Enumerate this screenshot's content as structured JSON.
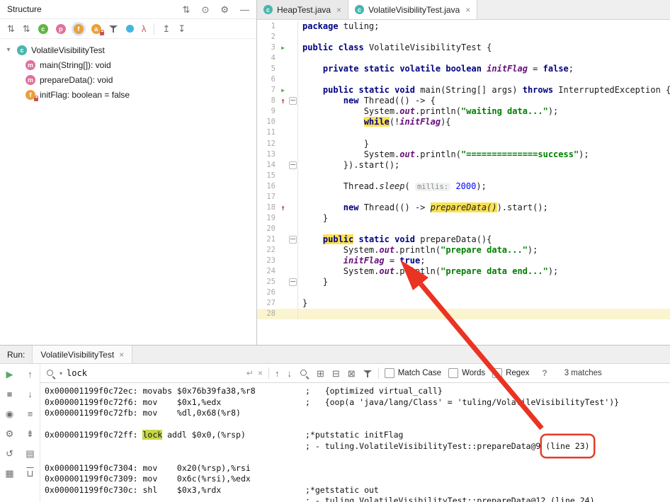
{
  "structure_panel": {
    "title": "Structure",
    "header_icons": [
      {
        "name": "sort-icon",
        "glyph": "⇅"
      },
      {
        "name": "locate-icon",
        "glyph": "⊙"
      },
      {
        "name": "settings-icon",
        "glyph": "⚙"
      },
      {
        "name": "hide-icon",
        "glyph": "—"
      }
    ],
    "toolbar_icons": [
      {
        "name": "sort-by-visibility-icon",
        "glyph": "⇅"
      },
      {
        "name": "sort-alphabetically-icon",
        "glyph": "⇅"
      },
      {
        "name": "show-inherited-icon",
        "chip": "c",
        "bg": "#62b543"
      },
      {
        "name": "show-properties-icon",
        "chip": "p",
        "bg": "#e0719c"
      },
      {
        "name": "show-fields-icon",
        "chip": "f",
        "bg": "#eaa13c",
        "selected": true
      },
      {
        "name": "show-anonymous-classes-icon",
        "chip": "a",
        "bg": "#eaa13c",
        "lock": true
      },
      {
        "name": "filter-icon",
        "funnel": true
      },
      {
        "name": "show-objects-icon",
        "dot": "#40b6e0"
      },
      {
        "name": "show-lambdas-icon",
        "glyph": "λ",
        "color": "#c75450"
      },
      {
        "name": "expand-all-icon",
        "glyph": "↥",
        "sep": true
      },
      {
        "name": "collapse-all-icon",
        "glyph": "↧"
      }
    ],
    "tree": [
      {
        "kind": "class",
        "label": "VolatileVisibilityTest",
        "icon": "c",
        "bg": "#49b6ad",
        "level": 0,
        "chevron": "▾"
      },
      {
        "kind": "method",
        "label": "main(String[]): void",
        "icon": "m",
        "bg": "#e0719c",
        "level": 1
      },
      {
        "kind": "method",
        "label": "prepareData(): void",
        "icon": "m",
        "bg": "#e0719c",
        "level": 1
      },
      {
        "kind": "field",
        "label": "initFlag: boolean = false",
        "icon": "f",
        "bg": "#eaa13c",
        "lock": true,
        "level": 1
      }
    ]
  },
  "editor": {
    "close_glyph": "×",
    "tabs": [
      {
        "label": "HeapTest.java",
        "active": false
      },
      {
        "label": "VolatileVisibilityTest.java",
        "active": true
      }
    ],
    "gutter_run_lines": [
      3,
      7
    ],
    "gutter_impl_lines": [
      8,
      18
    ],
    "fold_lines": [
      8,
      14,
      21,
      25
    ],
    "caret_line": 28,
    "lines": [
      {
        "n": 1,
        "s": [
          [
            "k",
            "package"
          ],
          [
            "p",
            " tuling;"
          ]
        ]
      },
      {
        "n": 2,
        "s": []
      },
      {
        "n": 3,
        "s": [
          [
            "k",
            "public"
          ],
          [
            "p",
            " "
          ],
          [
            "k",
            "class"
          ],
          [
            "p",
            " VolatileVisibilityTest {"
          ]
        ]
      },
      {
        "n": 4,
        "s": []
      },
      {
        "n": 5,
        "s": [
          [
            "p",
            "    "
          ],
          [
            "k",
            "private"
          ],
          [
            "p",
            " "
          ],
          [
            "k",
            "static"
          ],
          [
            "p",
            " "
          ],
          [
            "k",
            "volatile"
          ],
          [
            "p",
            " "
          ],
          [
            "k",
            "boolean"
          ],
          [
            "p",
            " "
          ],
          [
            "f",
            "initFlag"
          ],
          [
            "p",
            " = "
          ],
          [
            "k",
            "false"
          ],
          [
            "p",
            ";"
          ]
        ]
      },
      {
        "n": 6,
        "s": []
      },
      {
        "n": 7,
        "s": [
          [
            "p",
            "    "
          ],
          [
            "k",
            "public"
          ],
          [
            "p",
            " "
          ],
          [
            "k",
            "static"
          ],
          [
            "p",
            " "
          ],
          [
            "k",
            "void"
          ],
          [
            "p",
            " main(String[] args) "
          ],
          [
            "k",
            "throws"
          ],
          [
            "p",
            " InterruptedException {"
          ]
        ]
      },
      {
        "n": 8,
        "s": [
          [
            "p",
            "        "
          ],
          [
            "k",
            "new"
          ],
          [
            "p",
            " Thread(() -> {"
          ]
        ]
      },
      {
        "n": 9,
        "s": [
          [
            "p",
            "            System."
          ],
          [
            "f",
            "out"
          ],
          [
            "p",
            ".println("
          ],
          [
            "s2",
            "\"waiting data...\""
          ],
          [
            "p",
            ");"
          ]
        ]
      },
      {
        "n": 10,
        "s": [
          [
            "p",
            "            "
          ],
          [
            "khl",
            "while"
          ],
          [
            "p",
            "(!"
          ],
          [
            "f",
            "initFlag"
          ],
          [
            "p",
            "){"
          ]
        ]
      },
      {
        "n": 11,
        "s": []
      },
      {
        "n": 12,
        "s": [
          [
            "p",
            "            }"
          ]
        ]
      },
      {
        "n": 13,
        "s": [
          [
            "p",
            "            System."
          ],
          [
            "f",
            "out"
          ],
          [
            "p",
            ".println("
          ],
          [
            "s2",
            "\"==============success\""
          ],
          [
            "p",
            ");"
          ]
        ]
      },
      {
        "n": 14,
        "s": [
          [
            "p",
            "        }).start();"
          ]
        ]
      },
      {
        "n": 15,
        "s": []
      },
      {
        "n": 16,
        "s": [
          [
            "p",
            "        Thread."
          ],
          [
            "sm",
            "sleep"
          ],
          [
            "p",
            "( "
          ],
          [
            "hint",
            "millis:"
          ],
          [
            "p",
            " "
          ],
          [
            "num",
            "2000"
          ],
          [
            "p",
            ");"
          ]
        ]
      },
      {
        "n": 17,
        "s": []
      },
      {
        "n": 18,
        "s": [
          [
            "p",
            "        "
          ],
          [
            "k",
            "new"
          ],
          [
            "p",
            " Thread(() -> "
          ],
          [
            "smhl",
            "prepareData()"
          ],
          [
            "p",
            ").start();"
          ]
        ]
      },
      {
        "n": 19,
        "s": [
          [
            "p",
            "    }"
          ]
        ]
      },
      {
        "n": 20,
        "s": []
      },
      {
        "n": 21,
        "s": [
          [
            "p",
            "    "
          ],
          [
            "khl",
            "public"
          ],
          [
            "p",
            " "
          ],
          [
            "k",
            "static"
          ],
          [
            "p",
            " "
          ],
          [
            "k",
            "void"
          ],
          [
            "p",
            " prepareData(){"
          ]
        ]
      },
      {
        "n": 22,
        "s": [
          [
            "p",
            "        System."
          ],
          [
            "f",
            "out"
          ],
          [
            "p",
            ".println("
          ],
          [
            "s2",
            "\"prepare data...\""
          ],
          [
            "p",
            ");"
          ]
        ]
      },
      {
        "n": 23,
        "s": [
          [
            "p",
            "        "
          ],
          [
            "f",
            "initFlag"
          ],
          [
            "p",
            " = "
          ],
          [
            "k",
            "true"
          ],
          [
            "p",
            ";"
          ]
        ]
      },
      {
        "n": 24,
        "s": [
          [
            "p",
            "        System."
          ],
          [
            "f",
            "out"
          ],
          [
            "p",
            ".println("
          ],
          [
            "s2",
            "\"prepare data end...\""
          ],
          [
            "p",
            ");"
          ]
        ]
      },
      {
        "n": 25,
        "s": [
          [
            "p",
            "    }"
          ]
        ]
      },
      {
        "n": 26,
        "s": []
      },
      {
        "n": 27,
        "s": [
          [
            "p",
            "}"
          ]
        ]
      },
      {
        "n": 28,
        "s": []
      }
    ]
  },
  "run_panel": {
    "label": "Run:",
    "tab": {
      "label": "VolatileVisibilityTest",
      "close": "×"
    },
    "toolbar": {
      "left": [
        {
          "name": "rerun-button",
          "glyph": "▶",
          "color": "#59a869"
        },
        {
          "name": "stop-button",
          "glyph": "■",
          "color": "#9b9b9b"
        },
        {
          "name": "thread-dump-button",
          "glyph": "◉"
        },
        {
          "name": "settings-button",
          "glyph": "⚙"
        },
        {
          "name": "restore-layout-button",
          "glyph": "↺"
        },
        {
          "name": "pin-tab-button",
          "glyph": "▦"
        }
      ],
      "right": [
        {
          "name": "up-the-stack-button",
          "glyph": "↑"
        },
        {
          "name": "down-the-stack-button",
          "glyph": "↓"
        },
        {
          "name": "soft-wrap-button",
          "glyph": "≡"
        },
        {
          "name": "scroll-to-end-button",
          "glyph": "⇟"
        },
        {
          "name": "print-button",
          "glyph": "▤"
        },
        {
          "name": "clear-all-button",
          "glyph": "⊔",
          "cls": "trash"
        }
      ]
    },
    "search": {
      "query": "lock",
      "enter_icon": "↵",
      "clear_icon": "×",
      "nav_icons": [
        {
          "name": "previous-occurrence-icon",
          "glyph": "↑"
        },
        {
          "name": "next-occurrence-icon",
          "glyph": "↓"
        },
        {
          "name": "find-all-icon",
          "glyph": "mag"
        },
        {
          "name": "add-occurrence-icon",
          "glyph": "⊞"
        },
        {
          "name": "remove-occurrence-icon",
          "glyph": "⊟"
        },
        {
          "name": "select-all-occurrences-icon",
          "glyph": "⊠"
        },
        {
          "name": "filter-results-icon",
          "glyph": "funnel"
        }
      ],
      "options": [
        "Match Case",
        "Words",
        "Regex"
      ],
      "help": "?",
      "matches": "3 matches"
    },
    "console": {
      "lines": [
        {
          "a": [
            [
              "t",
              "0x000001199f0c72ec: movabs $0x76b39fa38,%r8"
            ]
          ],
          "c": [
            [
              "t",
              ";   {optimized virtual_call}"
            ]
          ]
        },
        {
          "a": [
            [
              "t",
              "0x000001199f0c72f6: mov    $0x1,%edx"
            ]
          ],
          "c": [
            [
              "t",
              ";   {oop(a 'java/lang/Class' = 'tuling/VolatileVisibilityTest')}"
            ]
          ]
        },
        {
          "a": [
            [
              "t",
              "0x000001199f0c72fb: mov    %dl,0x68(%r8)"
            ]
          ],
          "c": []
        },
        {
          "a": [],
          "c": []
        },
        {
          "a": [
            [
              "t",
              "0x000001199f0c72ff: "
            ],
            [
              "hl",
              "lock"
            ],
            [
              "t",
              " addl $0x0,(%rsp)"
            ]
          ],
          "c": [
            [
              "t",
              ";*putstatic initFlag"
            ]
          ]
        },
        {
          "a": [],
          "c": [
            [
              "t",
              "; - tuling.VolatileVisibilityTest::prepareData@9 "
            ],
            [
              "box",
              "(line 23)"
            ]
          ]
        },
        {
          "a": [],
          "c": []
        },
        {
          "a": [
            [
              "t",
              "0x000001199f0c7304: mov    0x20(%rsp),%rsi"
            ]
          ],
          "c": []
        },
        {
          "a": [
            [
              "t",
              "0x000001199f0c7309: mov    0x6c(%rsi),%edx"
            ]
          ],
          "c": []
        },
        {
          "a": [
            [
              "t",
              "0x000001199f0c730c: shl    $0x3,%rdx"
            ]
          ],
          "c": [
            [
              "t",
              ";*getstatic out"
            ]
          ]
        },
        {
          "a": [],
          "c": [
            [
              "t",
              "; - tuling.VolatileVisibilityTest::prepareData@12 (line 24)"
            ]
          ]
        }
      ]
    }
  }
}
